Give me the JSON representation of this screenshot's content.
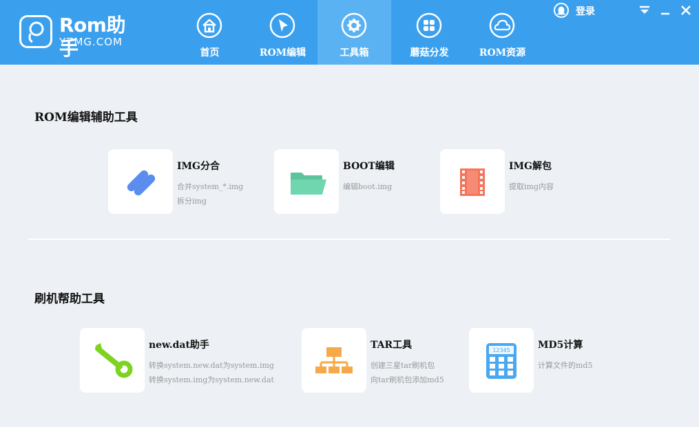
{
  "app": {
    "logo_main": "Rom助手",
    "logo_sub": "YZMG.COM"
  },
  "nav": {
    "items": [
      {
        "label": "首页",
        "icon": "home-icon"
      },
      {
        "label": "ROM编辑",
        "icon": "cursor-icon"
      },
      {
        "label": "工具箱",
        "icon": "gear-icon"
      },
      {
        "label": "蘑菇分发",
        "icon": "apps-grid-icon"
      },
      {
        "label": "ROM资源",
        "icon": "cloud-icon"
      }
    ],
    "active": "工具箱"
  },
  "header": {
    "login_label": "登录",
    "login_icon": "qq-icon"
  },
  "sections": [
    {
      "title": "ROM编辑辅助工具",
      "tools": [
        {
          "title": "IMG分合",
          "desc": [
            "合并system_*.img",
            "拆分img"
          ],
          "icon": "link-icon",
          "color": "#5b8def"
        },
        {
          "title": "BOOT编辑",
          "desc": [
            "编辑boot.img"
          ],
          "icon": "folder-icon",
          "color": "#6fd6b0"
        },
        {
          "title": "IMG解包",
          "desc": [
            "提取img内容"
          ],
          "icon": "film-icon",
          "color": "#f5745a"
        }
      ]
    },
    {
      "title": "刷机帮助工具",
      "tools": [
        {
          "title": "new.dat助手",
          "desc": [
            "转换system.new.dat为system.img",
            "转换system.img为system.new.dat"
          ],
          "icon": "wrench-icon",
          "color": "#7ed321"
        },
        {
          "title": "TAR工具",
          "desc": [
            "创建三星tar刷机包",
            "向tar刷机包添加md5"
          ],
          "icon": "hierarchy-icon",
          "color": "#f5a94a"
        },
        {
          "title": "MD5计算",
          "desc": [
            "计算文件的md5"
          ],
          "icon": "calculator-icon",
          "color": "#4aa8f0",
          "display_text": "12345"
        }
      ]
    }
  ],
  "colors": {
    "topbar": "#3aa0ee",
    "nav_active": "#5ab2f3",
    "background": "#edf1f5"
  }
}
